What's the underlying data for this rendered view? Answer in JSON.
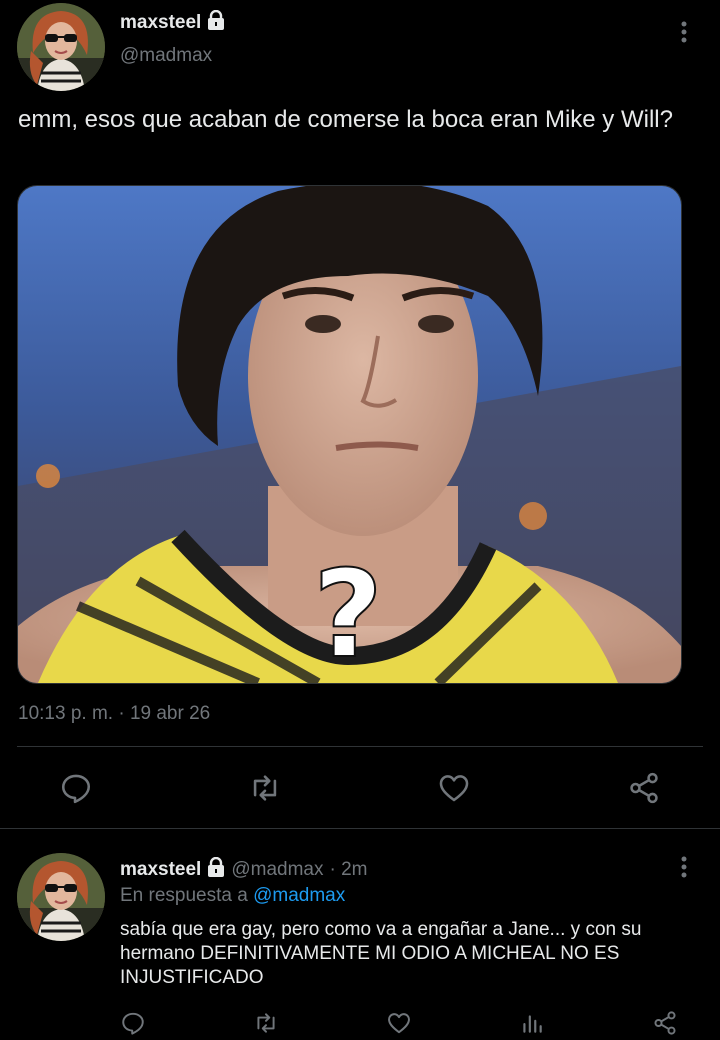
{
  "main_tweet": {
    "display_name": "maxsteel",
    "handle": "@madmax",
    "text": "emm, esos que acaban de comerse la boca eran Mike y Will?",
    "timestamp": "10:13 p. m. · 19 abr 26",
    "media_overlay": "?",
    "actions": [
      "reply-icon",
      "retweet-icon",
      "like-icon",
      "share-icon"
    ]
  },
  "reply_tweet": {
    "display_name": "maxsteel",
    "handle": "@madmax",
    "age": "· 2m",
    "replying_prefix": "En respuesta a",
    "replying_to": "@madmax",
    "text": "sabía que era gay, pero como va a engañar a Jane... y con su hermano DEFINITIVAMENTE MI ODIO A MICHEAL NO ES INJUSTIFICADO",
    "actions": [
      "reply-icon",
      "retweet-icon",
      "like-icon",
      "views-icon",
      "share-icon"
    ]
  },
  "colors": {
    "background": "#000000",
    "text": "#e7e9ea",
    "secondary": "#71767b",
    "link": "#1d9bf0",
    "divider": "#2f3336"
  }
}
